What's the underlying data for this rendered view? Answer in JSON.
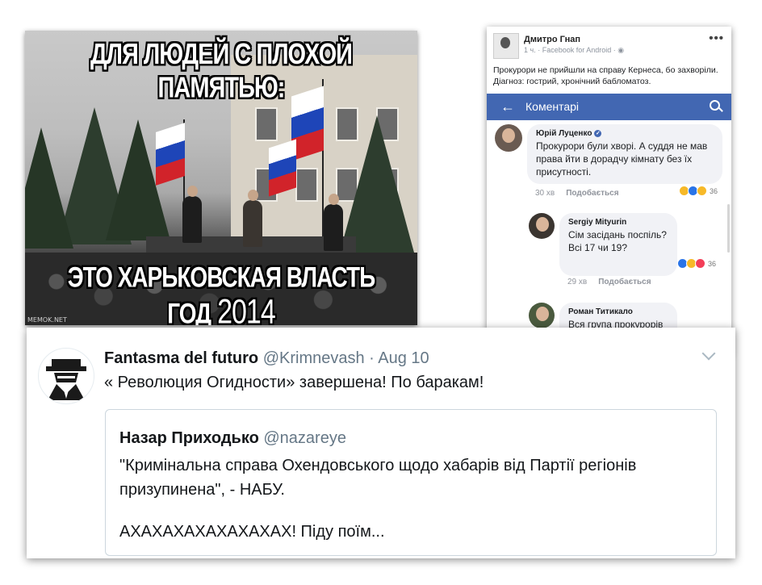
{
  "meme": {
    "caption_top": "ДЛЯ ЛЮДЕЙ С ПЛОХОЙ ПАМЯТЬЮ:",
    "caption_middle": "ЭТО ХАРЬКОВСКАЯ ВЛАСТЬ",
    "caption_bottom_label": "ГОД",
    "caption_bottom_year": "2014",
    "watermark": "MEMOK.NET"
  },
  "facebook": {
    "post": {
      "author": "Дмитро Гнап",
      "meta": "1 ч. · Facebook for Android · ◉",
      "more": "•••",
      "text": "Прокурори не прийшли на справу Кернеса, бо захворіли. Діагноз: гострий, хронічний бабломатоз."
    },
    "comments_bar": {
      "back": "←",
      "title": "Коментарі"
    },
    "comments": [
      {
        "name": "Юрій Луценко",
        "verified": "✓",
        "text": "Прокурори були хворі. А суддя не мав права йти в дорадчу кімнату без їх присутності.",
        "time": "30 хв",
        "like": "Подобається",
        "reactions": "36"
      },
      {
        "name": "Sergiy Mityurin",
        "text": "Сім засідань поспіль? Всі 17 чи 19?",
        "time": "29 хв",
        "like": "Подобається",
        "reactions": "36"
      },
      {
        "name": "Роман Титикало",
        "text": "Вся група прокурорів одразу?"
      }
    ],
    "colors": {
      "bar": "#4267b2",
      "bubble": "#f1f2f6"
    }
  },
  "tweet": {
    "name": "Fantasma del futuro",
    "handle": "@Krimnevash",
    "time": "· Aug 10",
    "text": "« Революция Огидности» завершена! По баракам!",
    "quote": {
      "name": "Назар Приходько",
      "handle": "@nazareye",
      "text": "\"Кримінальна справа Охендовського щодо хабарів від Партії регіонів призупинена\", - НАБУ.",
      "text2": "АХАХАХАХАХАХАХАХ! Піду поїм..."
    }
  }
}
